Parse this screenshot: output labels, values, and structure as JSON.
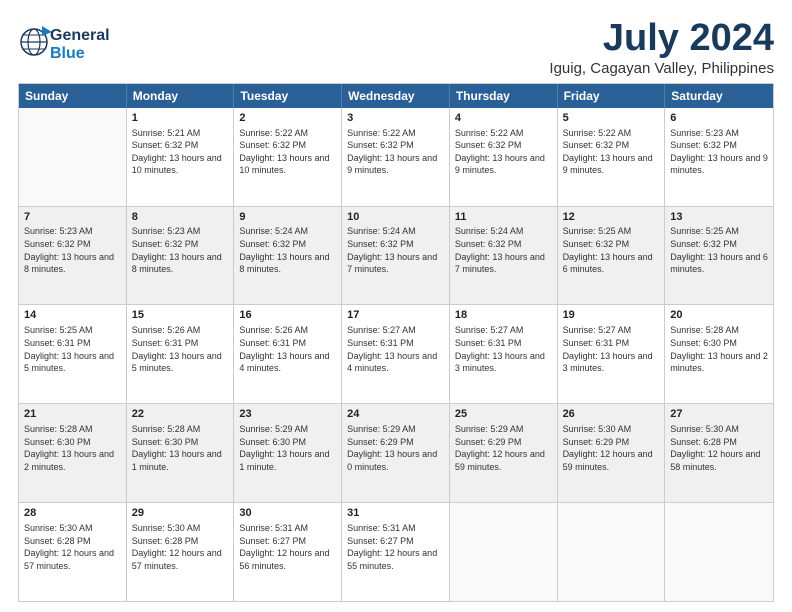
{
  "logo": {
    "general": "General",
    "blue": "Blue"
  },
  "header": {
    "month": "July 2024",
    "location": "Iguig, Cagayan Valley, Philippines"
  },
  "days": [
    "Sunday",
    "Monday",
    "Tuesday",
    "Wednesday",
    "Thursday",
    "Friday",
    "Saturday"
  ],
  "weeks": [
    [
      {
        "day": "",
        "sunrise": "",
        "sunset": "",
        "daylight": ""
      },
      {
        "day": "1",
        "sunrise": "Sunrise: 5:21 AM",
        "sunset": "Sunset: 6:32 PM",
        "daylight": "Daylight: 13 hours and 10 minutes."
      },
      {
        "day": "2",
        "sunrise": "Sunrise: 5:22 AM",
        "sunset": "Sunset: 6:32 PM",
        "daylight": "Daylight: 13 hours and 10 minutes."
      },
      {
        "day": "3",
        "sunrise": "Sunrise: 5:22 AM",
        "sunset": "Sunset: 6:32 PM",
        "daylight": "Daylight: 13 hours and 9 minutes."
      },
      {
        "day": "4",
        "sunrise": "Sunrise: 5:22 AM",
        "sunset": "Sunset: 6:32 PM",
        "daylight": "Daylight: 13 hours and 9 minutes."
      },
      {
        "day": "5",
        "sunrise": "Sunrise: 5:22 AM",
        "sunset": "Sunset: 6:32 PM",
        "daylight": "Daylight: 13 hours and 9 minutes."
      },
      {
        "day": "6",
        "sunrise": "Sunrise: 5:23 AM",
        "sunset": "Sunset: 6:32 PM",
        "daylight": "Daylight: 13 hours and 9 minutes."
      }
    ],
    [
      {
        "day": "7",
        "sunrise": "Sunrise: 5:23 AM",
        "sunset": "Sunset: 6:32 PM",
        "daylight": "Daylight: 13 hours and 8 minutes."
      },
      {
        "day": "8",
        "sunrise": "Sunrise: 5:23 AM",
        "sunset": "Sunset: 6:32 PM",
        "daylight": "Daylight: 13 hours and 8 minutes."
      },
      {
        "day": "9",
        "sunrise": "Sunrise: 5:24 AM",
        "sunset": "Sunset: 6:32 PM",
        "daylight": "Daylight: 13 hours and 8 minutes."
      },
      {
        "day": "10",
        "sunrise": "Sunrise: 5:24 AM",
        "sunset": "Sunset: 6:32 PM",
        "daylight": "Daylight: 13 hours and 7 minutes."
      },
      {
        "day": "11",
        "sunrise": "Sunrise: 5:24 AM",
        "sunset": "Sunset: 6:32 PM",
        "daylight": "Daylight: 13 hours and 7 minutes."
      },
      {
        "day": "12",
        "sunrise": "Sunrise: 5:25 AM",
        "sunset": "Sunset: 6:32 PM",
        "daylight": "Daylight: 13 hours and 6 minutes."
      },
      {
        "day": "13",
        "sunrise": "Sunrise: 5:25 AM",
        "sunset": "Sunset: 6:32 PM",
        "daylight": "Daylight: 13 hours and 6 minutes."
      }
    ],
    [
      {
        "day": "14",
        "sunrise": "Sunrise: 5:25 AM",
        "sunset": "Sunset: 6:31 PM",
        "daylight": "Daylight: 13 hours and 5 minutes."
      },
      {
        "day": "15",
        "sunrise": "Sunrise: 5:26 AM",
        "sunset": "Sunset: 6:31 PM",
        "daylight": "Daylight: 13 hours and 5 minutes."
      },
      {
        "day": "16",
        "sunrise": "Sunrise: 5:26 AM",
        "sunset": "Sunset: 6:31 PM",
        "daylight": "Daylight: 13 hours and 4 minutes."
      },
      {
        "day": "17",
        "sunrise": "Sunrise: 5:27 AM",
        "sunset": "Sunset: 6:31 PM",
        "daylight": "Daylight: 13 hours and 4 minutes."
      },
      {
        "day": "18",
        "sunrise": "Sunrise: 5:27 AM",
        "sunset": "Sunset: 6:31 PM",
        "daylight": "Daylight: 13 hours and 3 minutes."
      },
      {
        "day": "19",
        "sunrise": "Sunrise: 5:27 AM",
        "sunset": "Sunset: 6:31 PM",
        "daylight": "Daylight: 13 hours and 3 minutes."
      },
      {
        "day": "20",
        "sunrise": "Sunrise: 5:28 AM",
        "sunset": "Sunset: 6:30 PM",
        "daylight": "Daylight: 13 hours and 2 minutes."
      }
    ],
    [
      {
        "day": "21",
        "sunrise": "Sunrise: 5:28 AM",
        "sunset": "Sunset: 6:30 PM",
        "daylight": "Daylight: 13 hours and 2 minutes."
      },
      {
        "day": "22",
        "sunrise": "Sunrise: 5:28 AM",
        "sunset": "Sunset: 6:30 PM",
        "daylight": "Daylight: 13 hours and 1 minute."
      },
      {
        "day": "23",
        "sunrise": "Sunrise: 5:29 AM",
        "sunset": "Sunset: 6:30 PM",
        "daylight": "Daylight: 13 hours and 1 minute."
      },
      {
        "day": "24",
        "sunrise": "Sunrise: 5:29 AM",
        "sunset": "Sunset: 6:29 PM",
        "daylight": "Daylight: 13 hours and 0 minutes."
      },
      {
        "day": "25",
        "sunrise": "Sunrise: 5:29 AM",
        "sunset": "Sunset: 6:29 PM",
        "daylight": "Daylight: 12 hours and 59 minutes."
      },
      {
        "day": "26",
        "sunrise": "Sunrise: 5:30 AM",
        "sunset": "Sunset: 6:29 PM",
        "daylight": "Daylight: 12 hours and 59 minutes."
      },
      {
        "day": "27",
        "sunrise": "Sunrise: 5:30 AM",
        "sunset": "Sunset: 6:28 PM",
        "daylight": "Daylight: 12 hours and 58 minutes."
      }
    ],
    [
      {
        "day": "28",
        "sunrise": "Sunrise: 5:30 AM",
        "sunset": "Sunset: 6:28 PM",
        "daylight": "Daylight: 12 hours and 57 minutes."
      },
      {
        "day": "29",
        "sunrise": "Sunrise: 5:30 AM",
        "sunset": "Sunset: 6:28 PM",
        "daylight": "Daylight: 12 hours and 57 minutes."
      },
      {
        "day": "30",
        "sunrise": "Sunrise: 5:31 AM",
        "sunset": "Sunset: 6:27 PM",
        "daylight": "Daylight: 12 hours and 56 minutes."
      },
      {
        "day": "31",
        "sunrise": "Sunrise: 5:31 AM",
        "sunset": "Sunset: 6:27 PM",
        "daylight": "Daylight: 12 hours and 55 minutes."
      },
      {
        "day": "",
        "sunrise": "",
        "sunset": "",
        "daylight": ""
      },
      {
        "day": "",
        "sunrise": "",
        "sunset": "",
        "daylight": ""
      },
      {
        "day": "",
        "sunrise": "",
        "sunset": "",
        "daylight": ""
      }
    ]
  ]
}
